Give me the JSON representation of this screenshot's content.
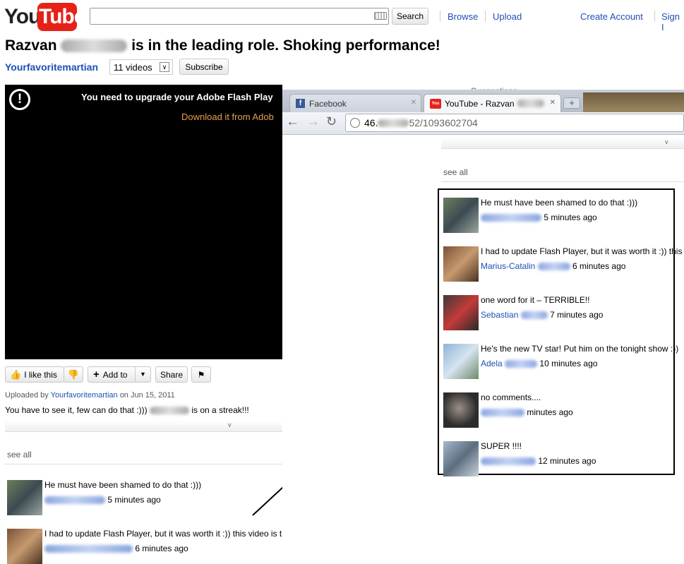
{
  "header": {
    "logo_you": "You",
    "logo_tube": "Tube",
    "search_button": "Search",
    "nav": [
      "Browse",
      "Upload"
    ],
    "create_account": "Create Account",
    "sign_in": "Sign I"
  },
  "video": {
    "title_first": "Razvan",
    "title_rest": "is in the leading role. Shoking performance!",
    "channel": "Yourfavoritemartian",
    "video_count": "11 videos",
    "subscribe": "Subscribe",
    "player_message": "You need to upgrade your Adobe Flash Play",
    "player_download": "Download it from Adob",
    "like": "I like this",
    "add_to": "Add to",
    "share": "Share",
    "uploaded_prefix": "Uploaded by",
    "uploader": "Yourfavoritemartian",
    "uploaded_date": "on Jun 15, 2011",
    "description_start": "You have to see it, few can do that :)))",
    "description_end": "is on a streak!!!",
    "see_all": "see all"
  },
  "left_comments": [
    {
      "text": "He must have been shamed to do that :)))",
      "time": "5 minutes ago"
    },
    {
      "text": "I had to update Flash Player, but it was worth it :)) this video is the very best!",
      "time": "6 minutes ago"
    }
  ],
  "browser": {
    "suggestions": "Suggestions",
    "tab_facebook": "Facebook",
    "tab_youtube": "YouTube - Razvan",
    "url_prefix": "46.",
    "url_suffix": "52/1093602704",
    "see_all": "see all"
  },
  "right_comments": [
    {
      "text": "He must have been shamed to do that :)))",
      "name": "",
      "time": "5 minutes ago"
    },
    {
      "text": "I had to update Flash Player, but it was worth it :)) this",
      "name": "Marius-Catalin",
      "time": "6 minutes ago"
    },
    {
      "text": "one word for it – TERRIBLE!!",
      "name": "Sebastian",
      "time": "7 minutes ago"
    },
    {
      "text": "He's the new TV star! Put him on the tonight show :))",
      "name": "Adela",
      "time": "10 minutes ago"
    },
    {
      "text": "no comments....",
      "name": "",
      "time": "minutes ago"
    },
    {
      "text": "SUPER !!!!",
      "name": "",
      "time": "12 minutes ago"
    }
  ],
  "colors": {
    "youtube_red": "#e62117",
    "link_blue": "#1f4fb5",
    "player_bg": "#000000",
    "download_orange": "#e8a04b"
  }
}
